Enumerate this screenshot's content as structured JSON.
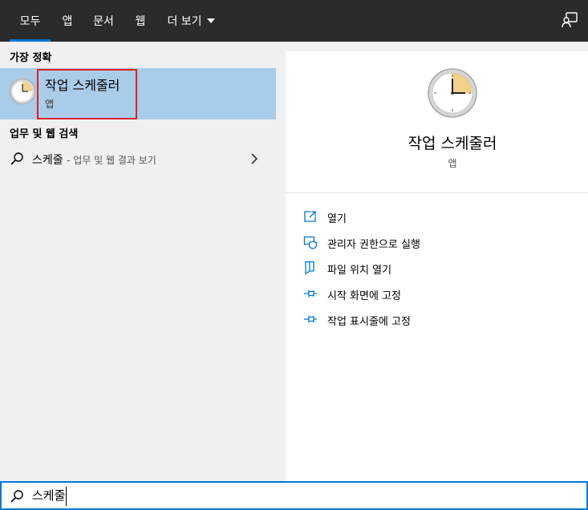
{
  "tabs": [
    {
      "label": "모두"
    },
    {
      "label": "앱"
    },
    {
      "label": "문서"
    },
    {
      "label": "웹"
    },
    {
      "label": "더 보기"
    }
  ],
  "left": {
    "best_match_heading": "가장 정확",
    "best_match": {
      "title": "작업 스케줄러",
      "subtitle": "앱",
      "icon": "task-scheduler-clock-icon"
    },
    "web_heading": "업무 및 웹 검색",
    "web_result": {
      "query": "스케줄",
      "suffix": "- 업무 및 웹 결과 보기"
    }
  },
  "right": {
    "title": "작업 스케줄러",
    "subtitle": "앱",
    "actions": [
      {
        "label": "열기",
        "icon": "open-icon"
      },
      {
        "label": "관리자 권한으로 실행",
        "icon": "shield-icon"
      },
      {
        "label": "파일 위치 열기",
        "icon": "file-location-icon"
      },
      {
        "label": "시작 화면에 고정",
        "icon": "pin-icon"
      },
      {
        "label": "작업 표시줄에 고정",
        "icon": "pin-icon"
      }
    ]
  },
  "search": {
    "value": "스케줄"
  },
  "colors": {
    "accent": "#0078d7",
    "selection": "#a9cce9",
    "highlight_border": "#e0202a",
    "topbar": "#2b2b2b"
  }
}
